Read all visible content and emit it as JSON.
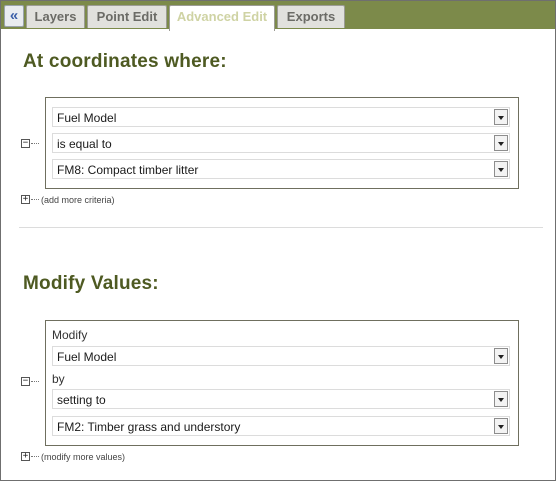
{
  "tabs": [
    {
      "label": "Layers",
      "active": false
    },
    {
      "label": "Point Edit",
      "active": false
    },
    {
      "label": "Advanced Edit",
      "active": true
    },
    {
      "label": "Exports",
      "active": false
    }
  ],
  "collapse_button": {
    "icon": "double-chevron-left-icon",
    "glyph": "«"
  },
  "criteria": {
    "title": "At coordinates where:",
    "field_select": "Fuel Model",
    "operator_select": "is equal to",
    "value_select": "FM8: Compact timber litter",
    "collapse_glyph": "−",
    "add_glyph": "+",
    "add_link": "(add more criteria)"
  },
  "modify": {
    "title": "Modify Values:",
    "modify_label": "Modify",
    "field_select": "Fuel Model",
    "by_label": "by",
    "method_select": "setting to",
    "value_select": "FM2: Timber grass and understory",
    "collapse_glyph": "−",
    "add_glyph": "+",
    "add_link": "(modify more values)"
  },
  "colors": {
    "tab_bar": "#7c8a4a",
    "heading": "#4e5a22",
    "active_tab_text": "#cfd3a4"
  }
}
